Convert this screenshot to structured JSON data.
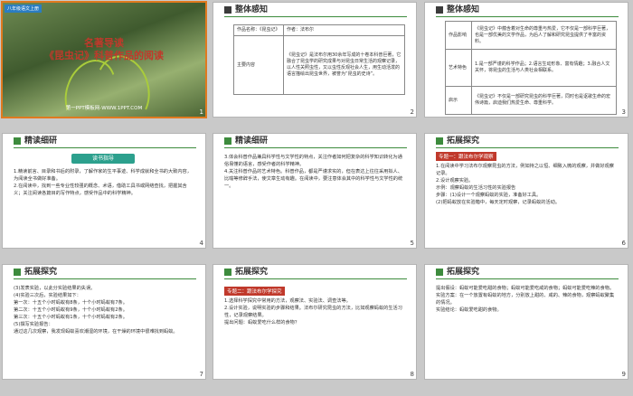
{
  "slides": [
    {
      "num": "1",
      "tag": "八年级语文上册",
      "title1": "名著导读",
      "title2": "《昆虫记》科普作品的阅读",
      "subtitle": "第一PPT模板网-WWW.1PPT.COM"
    },
    {
      "num": "2",
      "header": "整体感知",
      "r1_label": "作品名称：《昆虫记》",
      "r1_author": "作者：法布尔",
      "r2_label": "主要内容",
      "r2_text": "《昆虫记》是法布尔用30余年写成的十卷本科普巨著，它融合了昆虫学的研究成果与对昆虫日常生活的观察记录，以人性关照虫性，又以虫性反观社会人生，用生动活泼的语言描绘出昆虫世界，被誉为“昆虫的史诗”。"
    },
    {
      "num": "3",
      "header": "整体感知",
      "rows": [
        {
          "label": "作品影响",
          "text": "《昆虫记》中蕴含着对生命的尊重与热爱，它不仅是一部科学巨著，也是一部优美的文学作品，为后人了解和研究昆虫提供了丰富的资料。"
        },
        {
          "label": "艺术特色",
          "text": "1.是一部严谨的科学作品；2.语言生动形象、富有情趣；3.融合人文关怀，将昆虫的生活与人类社会相联系。"
        },
        {
          "label": "启示",
          "text": "《昆虫记》不仅是一部研究昆虫的科学巨著，同时也是讴歌生命的宏伟诗篇，启迪我们热爱生命、尊重科学。"
        }
      ]
    },
    {
      "num": "4",
      "header": "精读细研",
      "banner": "读书指导",
      "text": "1.精读前言、目录和书后的附录，了解作家的生平事迹、科学成就和全书的大致内容，为阅读全书做好准备。\n2.在阅读中，找到一些专业性较强的概念、术语，借助工具书或网络查找，把握其含义；关注阅读各篇目的写作特点，感受作品中的科学精神。"
    },
    {
      "num": "5",
      "header": "精读细研",
      "text": "3.体会科普作品兼具科学性与文学性的特点，关注作者如何把复杂的科学知识转化为通俗易懂的语言，感受作者的科学精神。\n4.关注科普作品的艺术特色。科普作品，都是严谨求实的，但在表达上往往采用拟人、比喻等修辞手法，使文章生动有趣。在阅读中，要注意体会其中的科学性与文学性的统一。"
    },
    {
      "num": "6",
      "header": "拓展探究",
      "topic": "专题一：跟法布尔学观察",
      "text": "1.在阅读中学习法布尔观察昆虫的方法，例如持之以恒、细致入微的观察，并做好观察记录。\n2.设计观察实验。\n示例：观察蚂蚁的生活习性的实验报告\n步骤：(1)设计一个观察蚂蚁的实验，准备好工具。\n(2)把蚂蚁放在实验箱中，每天定时观察，记录蚂蚁的活动。"
    },
    {
      "num": "7",
      "header": "拓展探究",
      "text": "(3)发表实验，以此分实验结果的失误。\n(4)实验三次后，实验结果如下：\n第一次：十五个小时蚂蚁有8条，十个小时蚂蚁有7条。\n第二次：十五个小时蚂蚁有9条，十个小时蚂蚁有2条。\n第三次：十五个小时蚂蚁有1条，十个小时蚂蚁有2条。\n(5)撰写实验报告：\n通过这几次观察，我发现蚂蚁喜欢潮湿的环境，在干燥的环境中很难找到蚂蚁。"
    },
    {
      "num": "8",
      "header": "拓展探究",
      "topic": "专题二：跟法布尔学探究",
      "text": "1.选择科学探究中常用的方法，观察法、实验法、调查法等。\n2.设计实验，说明实验的步骤和结果。法布尔研究昆虫的方法，比如观察蚂蚁的生活习性，记录观察结果。\n提出问题：蚂蚁爱吃什么样的食物？"
    },
    {
      "num": "9",
      "header": "拓展探究",
      "text": "提出假设：蚂蚁可能爱吃甜的食物；蚂蚁可能爱吃咸的食物；蚂蚁可能爱吃辣的食物。\n实验方案：在一个放置有蚂蚁的地方，分别放上甜的、咸的、辣的食物，观察蚂蚁聚集的情况。\n实验结论：蚂蚁爱吃甜的食物。"
    }
  ]
}
